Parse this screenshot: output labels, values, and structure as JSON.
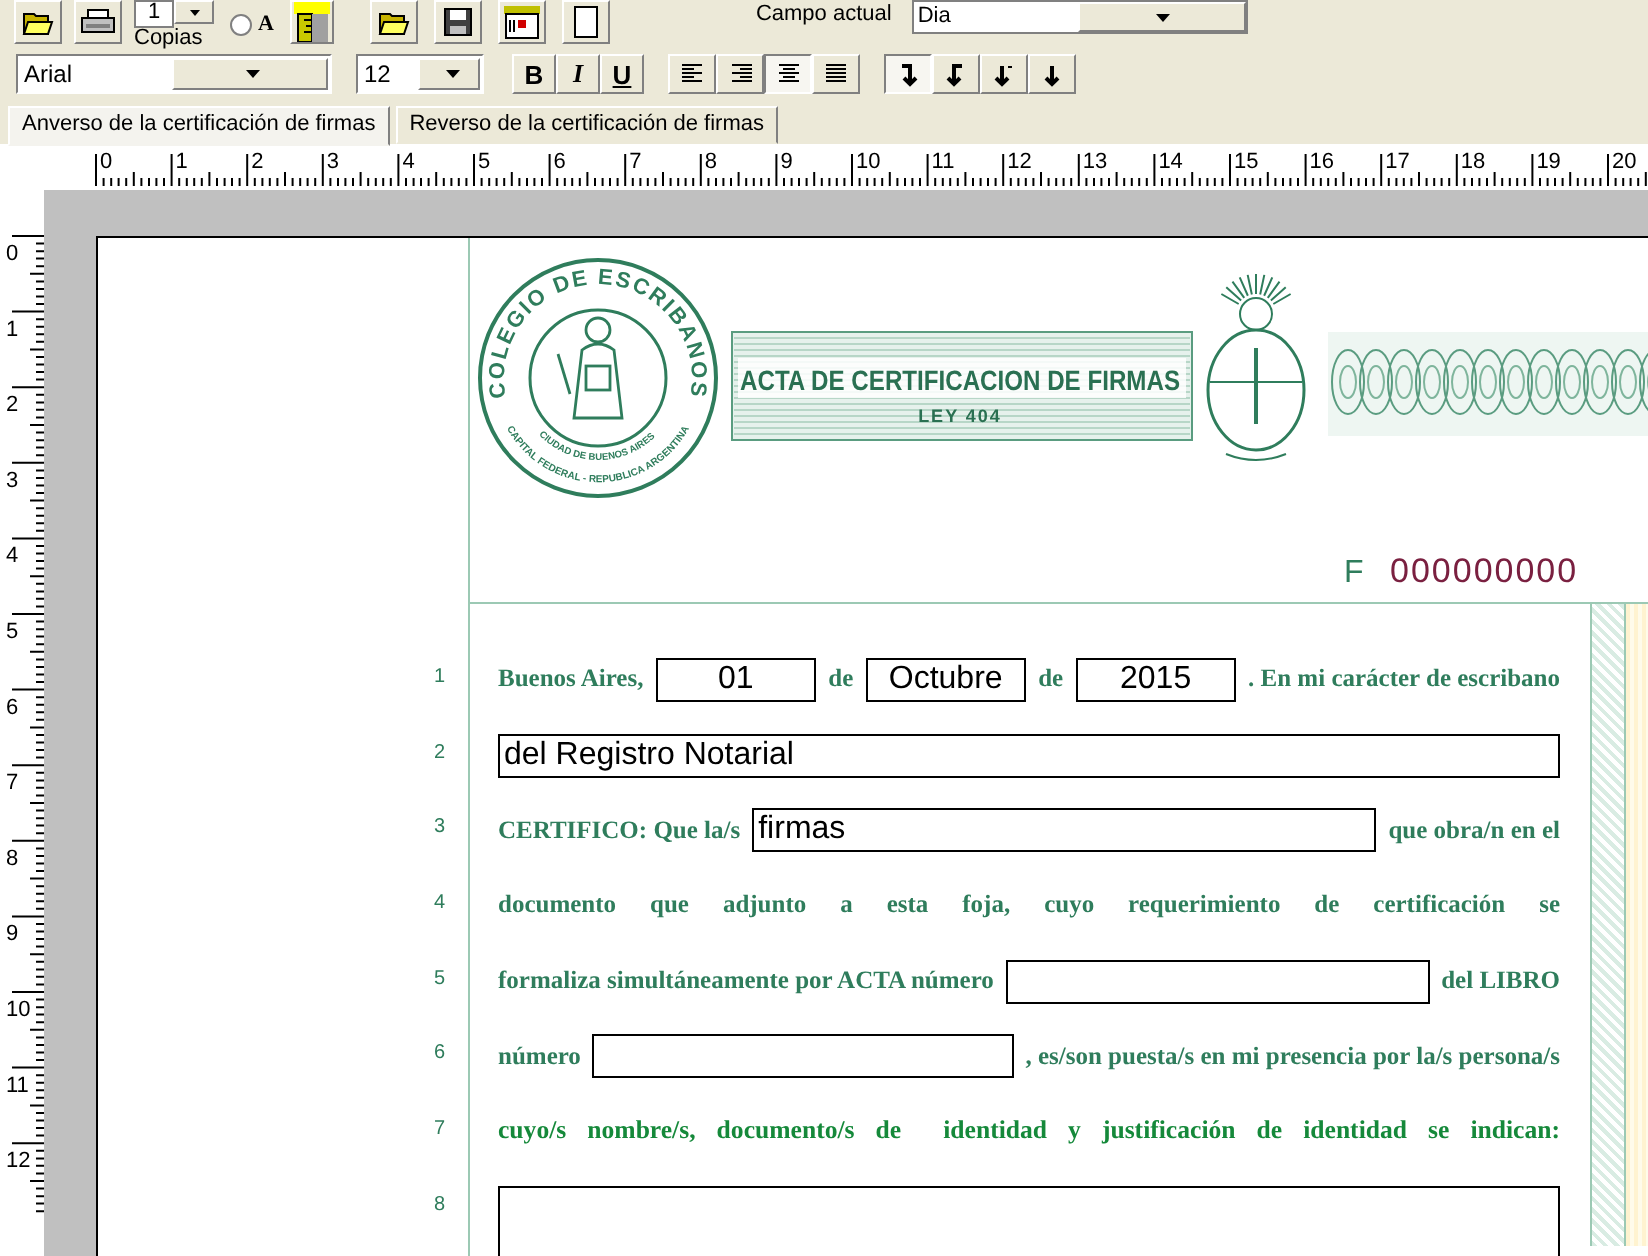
{
  "toolbar": {
    "copies": {
      "label": "Copias",
      "value": "1"
    },
    "radio": {
      "label": "A",
      "selected": false
    },
    "current_field": {
      "label": "Campo actual",
      "value": "Dia"
    }
  },
  "format_bar": {
    "font": "Arial",
    "size": "12",
    "style_buttons": [
      {
        "kind": "bold",
        "label": "B"
      },
      {
        "kind": "italic",
        "label": "I"
      },
      {
        "kind": "underline",
        "label": "U"
      }
    ],
    "align_buttons": [
      {
        "kind": "left",
        "selected": false
      },
      {
        "kind": "right",
        "selected": false
      },
      {
        "kind": "center",
        "selected": true
      },
      {
        "kind": "justify",
        "selected": false
      }
    ],
    "direction_buttons": [
      {
        "kind": "hook_left",
        "selected": true
      },
      {
        "kind": "hook_right",
        "selected": false
      },
      {
        "kind": "dotted",
        "selected": false
      },
      {
        "kind": "straight",
        "selected": false
      }
    ]
  },
  "tabs": [
    {
      "label": "Anverso de la certificación de firmas",
      "selected": true
    },
    {
      "label": "Reverso de la certificación de firmas",
      "selected": false
    }
  ],
  "rulers": {
    "horizontal": [
      "0",
      "1",
      "2",
      "3",
      "4",
      "5",
      "6",
      "7",
      "8",
      "9",
      "10",
      "11",
      "12",
      "13",
      "14",
      "15",
      "16",
      "17",
      "18",
      "19",
      "20"
    ],
    "vertical": [
      "0",
      "1",
      "2",
      "3",
      "4",
      "5",
      "6",
      "7",
      "8",
      "9",
      "10",
      "11",
      "12"
    ]
  },
  "certificate": {
    "seal": {
      "ring_text": "COLEGIO DE ESCRIBANOS",
      "lower_text": [
        "CIUDAD DE BUENOS AIRES",
        "CAPITAL FEDERAL - REPUBLICA ARGENTINA"
      ]
    },
    "banner": {
      "title": "ACTA DE CERTIFICACION DE FIRMAS",
      "subtitle": "LEY 404"
    },
    "serial": {
      "prefix": "F",
      "number": "000000000"
    },
    "lines": [
      {
        "number": "1",
        "parts": [
          {
            "kind": "text",
            "text": "Buenos Aires,"
          },
          {
            "kind": "field",
            "value": "01"
          },
          {
            "kind": "text",
            "text": "de"
          },
          {
            "kind": "field",
            "value": "Octubre"
          },
          {
            "kind": "text",
            "text": "de"
          },
          {
            "kind": "field",
            "value": "2015"
          },
          {
            "kind": "text",
            "text": ". En mi carácter de escribano"
          }
        ]
      },
      {
        "number": "2",
        "parts": [
          {
            "kind": "field",
            "value": "del Registro Notarial"
          }
        ]
      },
      {
        "number": "3",
        "parts": [
          {
            "kind": "text",
            "text": "CERTIFICO: Que la/s"
          },
          {
            "kind": "field",
            "value": "firmas"
          },
          {
            "kind": "text",
            "text": "que obra/n en el"
          }
        ]
      },
      {
        "number": "4",
        "parts": [
          {
            "kind": "text",
            "text": "documento que adjunto a esta foja, cuyo requerimiento de certificación se"
          }
        ]
      },
      {
        "number": "5",
        "parts": [
          {
            "kind": "text",
            "text": "formaliza simultáneamente por ACTA número"
          },
          {
            "kind": "field"
          },
          {
            "kind": "text",
            "text": "del LIBRO"
          }
        ]
      },
      {
        "number": "6",
        "parts": [
          {
            "kind": "text",
            "text": "número"
          },
          {
            "kind": "field"
          },
          {
            "kind": "text",
            "text": ", es/son puesta/s en mi presencia por la/s persona/s"
          }
        ]
      },
      {
        "number": "7",
        "parts": [
          {
            "kind": "strong_text",
            "text": "cuyo/s nombre/s, documento/s de  identidad y justificación de identidad se indican:"
          }
        ]
      },
      {
        "number": "8",
        "parts": [
          {
            "kind": "area"
          }
        ]
      }
    ]
  }
}
